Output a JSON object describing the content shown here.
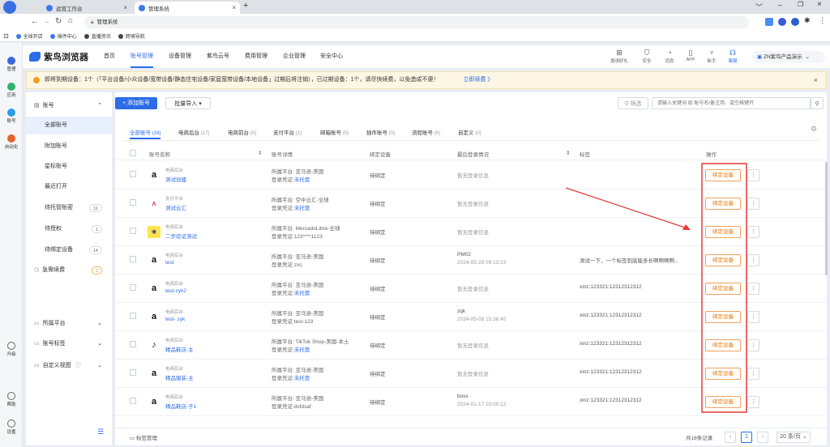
{
  "browser": {
    "tabs": [
      {
        "label": "运营工作台"
      },
      {
        "label": "管理系统"
      }
    ],
    "url": "管理系统",
    "bookmarks": [
      {
        "label": "全球开店"
      },
      {
        "label": "插件中心"
      },
      {
        "label": "直播资讯"
      },
      {
        "label": "跨境导航"
      }
    ]
  },
  "rail": {
    "items": [
      {
        "label": "管理",
        "icon": "grid-icon",
        "color": "#3b67d9"
      },
      {
        "label": "应用",
        "icon": "app-icon",
        "color": "#2fb36b"
      },
      {
        "label": "账号",
        "icon": "account-icon",
        "color": "#2d9ee6"
      },
      {
        "label": "自动化",
        "icon": "automation-icon",
        "color": "#e8602c"
      },
      {
        "label": "升级",
        "icon": "upgrade-icon",
        "color": "#666"
      },
      {
        "label": "帮助",
        "icon": "help-icon",
        "color": "#666"
      },
      {
        "label": "设置",
        "icon": "settings-icon",
        "color": "#666"
      }
    ]
  },
  "header": {
    "brand": "紫鸟浏览器",
    "nav": [
      {
        "label": "首页"
      },
      {
        "label": "账号管理"
      },
      {
        "label": "设备管理"
      },
      {
        "label": "紫鸟云号"
      },
      {
        "label": "费用管理"
      },
      {
        "label": "企业管理"
      },
      {
        "label": "安全中心"
      }
    ],
    "tools": [
      {
        "label": "邀请好礼",
        "icon": "gift-icon"
      },
      {
        "label": "安全",
        "icon": "shield-icon"
      },
      {
        "label": "消息",
        "icon": "bell-icon"
      },
      {
        "label": "APP",
        "icon": "phone-icon"
      },
      {
        "label": "新手",
        "icon": "rocket-icon"
      },
      {
        "label": "客服",
        "icon": "headset-icon"
      }
    ],
    "user": "ZN紫鸟产品演示"
  },
  "notice": {
    "text": "即将到期设备：1个（「平台设备/小众设备/宽带设备/静态住宅设备/家庭宽带设备/本地设备」过期后将注销），已过期设备：1个，请尽快续费，以免造成不便！",
    "link": "立即续费 》"
  },
  "left_panel": {
    "group": "账号",
    "items": [
      {
        "label": "全部账号",
        "count": ""
      },
      {
        "label": "附加账号",
        "count": ""
      },
      {
        "label": "星标账号",
        "count": ""
      },
      {
        "label": "最近打开",
        "count": ""
      },
      {
        "label": "待托管账密",
        "count": "11"
      },
      {
        "label": "待授权",
        "count": "1"
      },
      {
        "label": "待绑定设备",
        "count": "14"
      }
    ],
    "renew": {
      "label": "急需续费",
      "count": "2"
    },
    "bottom": [
      {
        "label": "所属平台"
      },
      {
        "label": "账号标签"
      },
      {
        "label": "自定义视图"
      }
    ]
  },
  "toolbar": {
    "add_label": "+ 添加账号",
    "import_label": "批量导入",
    "filter_label": "筛选",
    "search_placeholder": "请输入关键词 如 账号名/备注用、或空格键开"
  },
  "subtabs": [
    {
      "label": "全部账号",
      "count": "(18)"
    },
    {
      "label": "电商后台",
      "count": "(17)"
    },
    {
      "label": "电商前台",
      "count": "(0)"
    },
    {
      "label": "支付平台",
      "count": "(1)"
    },
    {
      "label": "邮箱账号",
      "count": "(0)"
    },
    {
      "label": "插件账号",
      "count": "(0)"
    },
    {
      "label": "流程账号",
      "count": "(0)"
    },
    {
      "label": "自定义",
      "count": "(0)"
    }
  ],
  "table": {
    "headers": [
      "账号名称",
      "账号详情",
      "绑定设备",
      "最后登录情况",
      "标签",
      "操作"
    ],
    "rows": [
      {
        "type": "电商后台",
        "name": "测试创建",
        "logo": "a",
        "platform": "所属平台: 亚马逊-美国",
        "cred_label": "登录凭证:",
        "cred": "未托管",
        "cred_link": true,
        "device": "待绑定",
        "login1": "暂无登录信息",
        "login2": "",
        "tag": "",
        "action": "绑定设备"
      },
      {
        "type": "支付平台",
        "name": "测试云汇",
        "logo": "w",
        "platform": "所属平台: 空中云汇-全球",
        "cred_label": "登录凭证:",
        "cred": "未托管",
        "cred_link": true,
        "device": "待绑定",
        "login1": "暂无登录信息",
        "login2": "",
        "tag": "",
        "action": "绑定设备"
      },
      {
        "type": "电商后台",
        "name": "二步验证测试",
        "logo": "m",
        "platform": "所属平台: MercadoLibre-全球",
        "cred_label": "登录凭证:",
        "cred": "123****1123",
        "cred_link": false,
        "device": "待绑定",
        "login1": "暂无登录信息",
        "login2": "",
        "tag": "",
        "action": "绑定设备"
      },
      {
        "type": "电商后台",
        "name": "test",
        "logo": "a",
        "platform": "所属平台: 亚马逊-美国",
        "cred_label": "登录凭证:",
        "cred": "zxc",
        "cred_link": false,
        "device": "待绑定",
        "login1": "PM02",
        "login2": "2024-05-29 09:13:23",
        "tag": "测试一下，一个标签到底能多长啊啊啊啊...",
        "action": "绑定设备"
      },
      {
        "type": "电商后台",
        "name": "test-zyk2",
        "logo": "a",
        "platform": "所属平台: 亚马逊-美国",
        "cred_label": "登录凭证:",
        "cred": "未托管",
        "cred_link": true,
        "device": "待绑定",
        "login1": "暂无登录信息",
        "login2": "",
        "tag": "xinz:123321:12312312312",
        "action": "绑定设备"
      },
      {
        "type": "电商后台",
        "name": "test- zyk",
        "logo": "a",
        "platform": "所属平台: 亚马逊-美国",
        "cred_label": "登录凭证:",
        "cred": "test-123",
        "cred_link": false,
        "device": "待绑定",
        "login1": "zqk",
        "login2": "2024-05-08 15:36:40",
        "tag": "xinz:123321:12312312312",
        "action": "绑定设备"
      },
      {
        "type": "电商后台",
        "name": "精品鞋店-主",
        "logo": "t",
        "platform": "所属平台: TikTok Shop-美国-本土",
        "cred_label": "登录凭证:",
        "cred": "未托管",
        "cred_link": true,
        "device": "待绑定",
        "login1": "暂无登录信息",
        "login2": "",
        "tag": "xinz:123321:12312312312",
        "action": "绑定设备"
      },
      {
        "type": "电商后台",
        "name": "精品服装-主",
        "logo": "a",
        "platform": "所属平台: 亚马逊-美国",
        "cred_label": "登录凭证:",
        "cred": "未托管",
        "cred_link": true,
        "device": "待绑定",
        "login1": "暂无登录信息",
        "login2": "",
        "tag": "xinz:123321:12312312312",
        "action": "绑定设备"
      },
      {
        "type": "电商后台",
        "name": "精品鞋店-子1",
        "logo": "a",
        "platform": "所属平台: 亚马逊-美国",
        "cred_label": "登录凭证:",
        "cred": "dsfdsaf",
        "cred_link": false,
        "device": "待绑定",
        "login1": "boss",
        "login2": "2024-01-17 10:00:12",
        "tag": "xinz:123321:12312312312",
        "action": "绑定设备"
      }
    ]
  },
  "footer": {
    "tag_manage": "标签管理",
    "total": "共18条记录",
    "page": "1",
    "page_size": "20 条/页"
  },
  "colors": {
    "accent": "#2d6ce6",
    "annotation": "#e53935",
    "warning": "#e8780d"
  }
}
